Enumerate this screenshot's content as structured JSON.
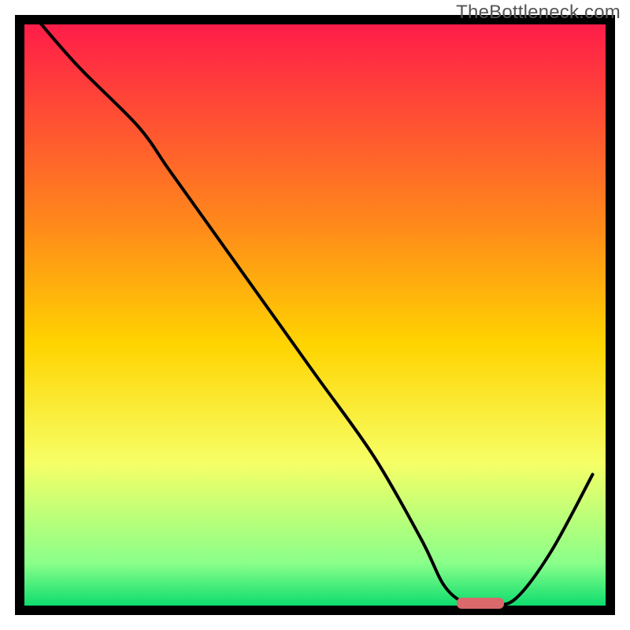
{
  "watermark": "TheBottleneck.com",
  "chart_data": {
    "type": "line",
    "title": "",
    "xlabel": "",
    "ylabel": "",
    "xlim": [
      0,
      100
    ],
    "ylim": [
      0,
      100
    ],
    "axes_visible": false,
    "background": {
      "type": "vertical_gradient",
      "stops": [
        {
          "offset": 0,
          "color": "#ff1a4a"
        },
        {
          "offset": 35,
          "color": "#ff8a1a"
        },
        {
          "offset": 55,
          "color": "#ffd400"
        },
        {
          "offset": 75,
          "color": "#f6ff66"
        },
        {
          "offset": 92,
          "color": "#8aff8a"
        },
        {
          "offset": 100,
          "color": "#00d96b"
        }
      ]
    },
    "inner_border_color": "#000000",
    "inner_border_width": 8,
    "series": [
      {
        "name": "curve",
        "color": "#000000",
        "x": [
          3,
          10,
          20,
          25,
          30,
          40,
          50,
          60,
          68,
          72,
          76,
          80,
          84,
          90,
          97
        ],
        "y": [
          100,
          92,
          82,
          75,
          68,
          54,
          40,
          26,
          12,
          4,
          1,
          1,
          2,
          10,
          23
        ]
      }
    ],
    "marker": {
      "name": "optimal-range-pill",
      "x_center": 78,
      "y": 1.2,
      "width": 8,
      "color": "#d9696b"
    }
  }
}
